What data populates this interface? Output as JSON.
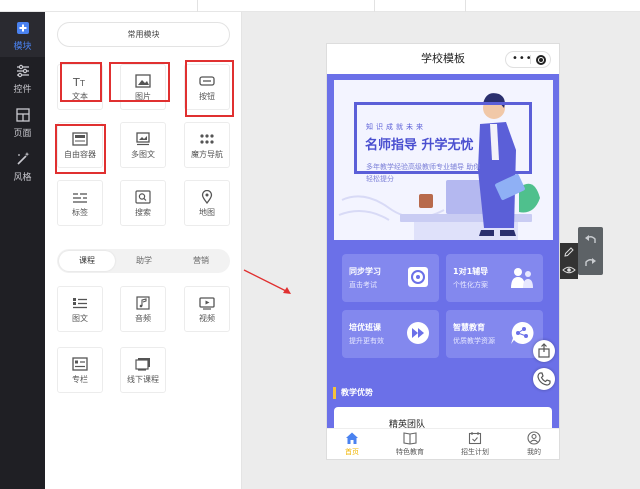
{
  "rail": {
    "items": [
      {
        "label": "模块",
        "icon": "add-square-icon",
        "active": true
      },
      {
        "label": "控件",
        "icon": "sliders-icon",
        "active": false
      },
      {
        "label": "页面",
        "icon": "page-layout-icon",
        "active": false
      },
      {
        "label": "风格",
        "icon": "magic-wand-icon",
        "active": false
      }
    ]
  },
  "panel": {
    "title": "常用模块",
    "common": [
      {
        "label": "文本",
        "icon": "text-icon"
      },
      {
        "label": "图片",
        "icon": "image-icon"
      },
      {
        "label": "按钮",
        "icon": "button-icon"
      },
      {
        "label": "自由容器",
        "icon": "container-icon"
      },
      {
        "label": "多图文",
        "icon": "multi-image-text-icon"
      },
      {
        "label": "魔方导航",
        "icon": "grid-nav-icon"
      },
      {
        "label": "标签",
        "icon": "tag-icon"
      },
      {
        "label": "搜索",
        "icon": "search-icon"
      },
      {
        "label": "地图",
        "icon": "map-pin-icon"
      }
    ],
    "tabs": [
      "课程",
      "助学",
      "营销"
    ],
    "course": [
      {
        "label": "图文",
        "icon": "article-icon"
      },
      {
        "label": "音频",
        "icon": "audio-icon"
      },
      {
        "label": "视频",
        "icon": "video-icon"
      },
      {
        "label": "专栏",
        "icon": "column-icon"
      },
      {
        "label": "线下课程",
        "icon": "offline-course-icon"
      }
    ]
  },
  "phone": {
    "title": "学校模板",
    "banner": {
      "small": "知识成就未来",
      "big": "名师指导 升学无忧",
      "desc": "多年教学经验高级教师专业辅导 助你轻松提分"
    },
    "cards": [
      {
        "title": "同步学习",
        "sub": "直击考试",
        "icon": "book-icon"
      },
      {
        "title": "1对1辅导",
        "sub": "个性化方案",
        "icon": "people-icon"
      },
      {
        "title": "培优班课",
        "sub": "提升更有效",
        "icon": "fast-forward-icon"
      },
      {
        "title": "智慧教育",
        "sub": "优质教学资源",
        "icon": "chat-bubble-icon"
      }
    ],
    "section": "教学优势",
    "team": "精英团队",
    "tabbar": [
      {
        "label": "首页",
        "icon": "home-icon",
        "active": true
      },
      {
        "label": "特色教育",
        "icon": "open-book-icon",
        "active": false
      },
      {
        "label": "招生计划",
        "icon": "calendar-check-icon",
        "active": false
      },
      {
        "label": "我的",
        "icon": "user-icon",
        "active": false
      }
    ]
  },
  "colors": {
    "accent": "#4a82f0",
    "highlight": "#e03030",
    "phoneBg": "#6b70e8",
    "tabActive": "#f0b400"
  }
}
